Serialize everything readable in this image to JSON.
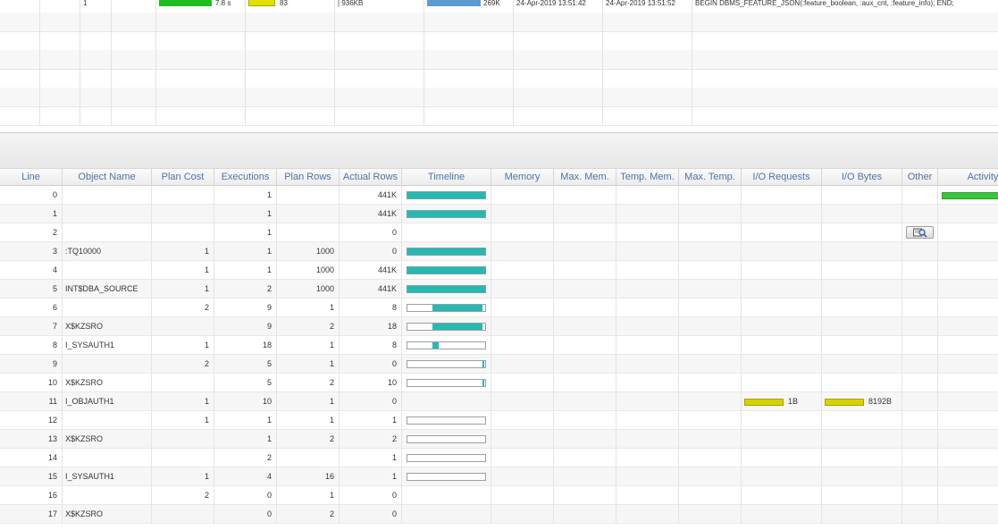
{
  "top_grid": {
    "row": {
      "num": "1",
      "duration": "7.8 s",
      "duration_level": 0.75,
      "count": "83",
      "memory": "936KB",
      "bytes": "269K",
      "start": "24-Apr-2019 13:51:42",
      "end": "24-Apr-2019 13:51:52",
      "sql": "BEGIN DBMS_FEATURE_JSON(:feature_boolean, :aux_cnt, :feature_info);  END;"
    },
    "colors": {
      "green": "#1cbf1c",
      "yellow": "#e2e000",
      "blue": "#5b9bd0"
    }
  },
  "plan": {
    "headers": [
      "Line",
      "Object Name",
      "Plan Cost",
      "Executions",
      "Plan Rows",
      "Actual Rows",
      "Timeline",
      "Memory",
      "Max. Mem.",
      "Temp. Mem.",
      "Max. Temp.",
      "I/O Requests",
      "I/O Bytes",
      "Other",
      "Activity"
    ],
    "rows": [
      {
        "line": "0",
        "object": "",
        "cost": "",
        "exec": "1",
        "plan_rows": "",
        "actual": "441K",
        "tl_start": 0.0,
        "tl_width": 1.0,
        "tl_empty": false
      },
      {
        "line": "1",
        "object": "",
        "cost": "",
        "exec": "1",
        "plan_rows": "",
        "actual": "441K",
        "tl_start": 0.0,
        "tl_width": 1.0,
        "tl_empty": false
      },
      {
        "line": "2",
        "object": "",
        "cost": "",
        "exec": "1",
        "plan_rows": "",
        "actual": "0",
        "tl_start": 0,
        "tl_width": 0,
        "tl_empty": true
      },
      {
        "line": "3",
        "object": ":TQ10000",
        "cost": "1",
        "exec": "1",
        "plan_rows": "1000",
        "actual": "0",
        "tl_start": 0.0,
        "tl_width": 1.0,
        "tl_empty": false
      },
      {
        "line": "4",
        "object": "",
        "cost": "1",
        "exec": "1",
        "plan_rows": "1000",
        "actual": "441K",
        "tl_start": 0.0,
        "tl_width": 1.0,
        "tl_empty": false
      },
      {
        "line": "5",
        "object": "INT$DBA_SOURCE",
        "cost": "1",
        "exec": "2",
        "plan_rows": "1000",
        "actual": "441K",
        "tl_start": 0.0,
        "tl_width": 1.0,
        "tl_empty": false
      },
      {
        "line": "6",
        "object": "",
        "cost": "2",
        "exec": "9",
        "plan_rows": "1",
        "actual": "8",
        "tl_start": 0.32,
        "tl_width": 0.65,
        "tl_empty": false
      },
      {
        "line": "7",
        "object": "X$KZSRO",
        "cost": "",
        "exec": "9",
        "plan_rows": "2",
        "actual": "18",
        "tl_start": 0.32,
        "tl_width": 0.65,
        "tl_empty": false
      },
      {
        "line": "8",
        "object": "I_SYSAUTH1",
        "cost": "1",
        "exec": "18",
        "plan_rows": "1",
        "actual": "8",
        "tl_start": 0.32,
        "tl_width": 0.08,
        "tl_empty": false
      },
      {
        "line": "9",
        "object": "",
        "cost": "2",
        "exec": "5",
        "plan_rows": "1",
        "actual": "0",
        "tl_start": 0.97,
        "tl_width": 0.02,
        "tl_empty": false
      },
      {
        "line": "10",
        "object": "X$KZSRO",
        "cost": "",
        "exec": "5",
        "plan_rows": "2",
        "actual": "10",
        "tl_start": 0.97,
        "tl_width": 0.02,
        "tl_empty": false
      },
      {
        "line": "11",
        "object": "I_OBJAUTH1",
        "cost": "1",
        "exec": "10",
        "plan_rows": "1",
        "actual": "0",
        "tl_start": 0,
        "tl_width": 0,
        "tl_empty": true
      },
      {
        "line": "12",
        "object": "",
        "cost": "1",
        "exec": "1",
        "plan_rows": "1",
        "actual": "1",
        "tl_start": 0,
        "tl_width": 0,
        "tl_empty": false
      },
      {
        "line": "13",
        "object": "X$KZSRO",
        "cost": "",
        "exec": "1",
        "plan_rows": "2",
        "actual": "2",
        "tl_start": 0,
        "tl_width": 0,
        "tl_empty": false
      },
      {
        "line": "14",
        "object": "",
        "cost": "",
        "exec": "2",
        "plan_rows": "",
        "actual": "1",
        "tl_start": 0,
        "tl_width": 0,
        "tl_empty": false
      },
      {
        "line": "15",
        "object": "I_SYSAUTH1",
        "cost": "1",
        "exec": "4",
        "plan_rows": "16",
        "actual": "1",
        "tl_start": 0,
        "tl_width": 0,
        "tl_empty": false
      },
      {
        "line": "16",
        "object": "",
        "cost": "2",
        "exec": "0",
        "plan_rows": "1",
        "actual": "0",
        "tl_start": 0,
        "tl_width": 0,
        "tl_empty": true
      },
      {
        "line": "17",
        "object": "X$KZSRO",
        "cost": "",
        "exec": "0",
        "plan_rows": "2",
        "actual": "0",
        "tl_start": 0,
        "tl_width": 0,
        "tl_empty": true
      }
    ],
    "io": {
      "row_line": "11",
      "requests": "1B",
      "bytes": "8192B"
    },
    "other_icon": "magnifier-icon",
    "activity_level": 1.0
  }
}
